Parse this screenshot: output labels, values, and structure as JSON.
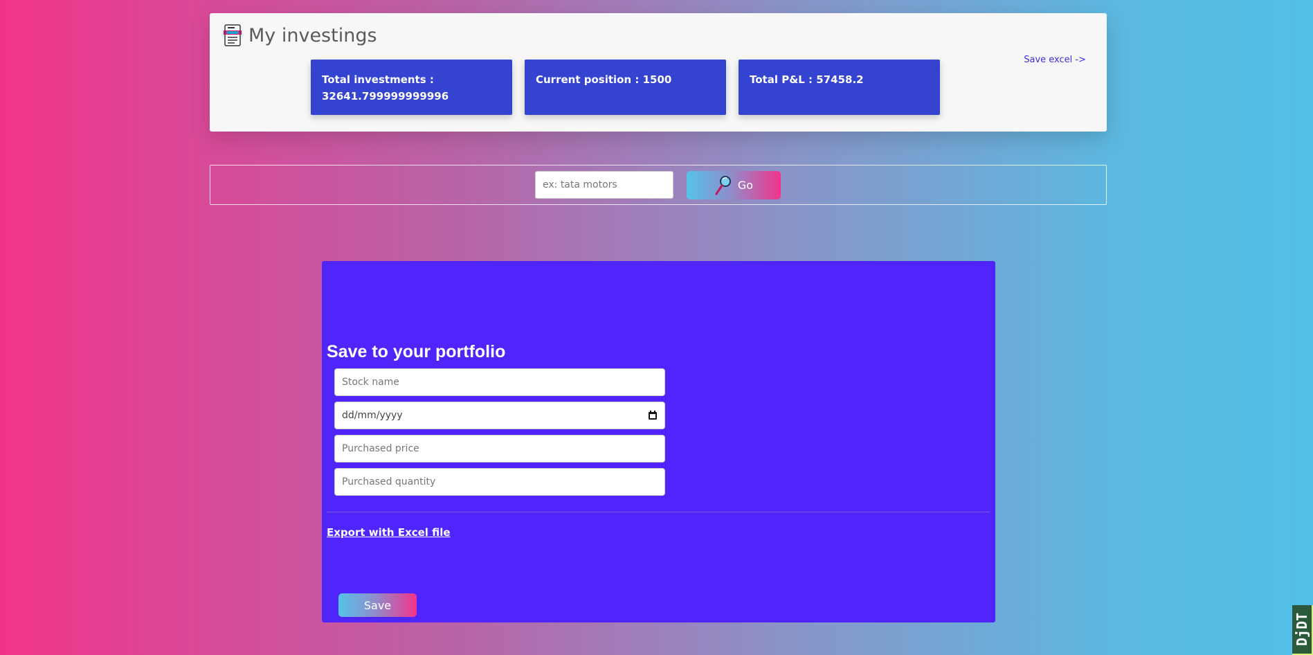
{
  "header": {
    "title": "My investings",
    "icon": "document-icon",
    "save_excel_link": "Save excel ->"
  },
  "stats": [
    {
      "label": "Total investments : 32641.799999999996"
    },
    {
      "label": "Current position : 1500"
    },
    {
      "label": "Total P&L : 57458.2"
    }
  ],
  "search": {
    "placeholder": "ex: tata motors",
    "go_label": "Go",
    "icon": "magnifier-icon"
  },
  "portfolio": {
    "title": "Save to your portfolio",
    "stock_name_placeholder": "Stock name",
    "date_placeholder": "dd/mm/yyyy",
    "price_placeholder": "Purchased price",
    "quantity_placeholder": "Purchased quantity",
    "export_link": "Export with Excel file",
    "save_label": "Save"
  },
  "debug_toolbar": {
    "label": "DjDT"
  },
  "colors": {
    "stat_card": "#3444d1",
    "portfolio_panel": "#4f25fb",
    "link": "#3b2ee0"
  }
}
